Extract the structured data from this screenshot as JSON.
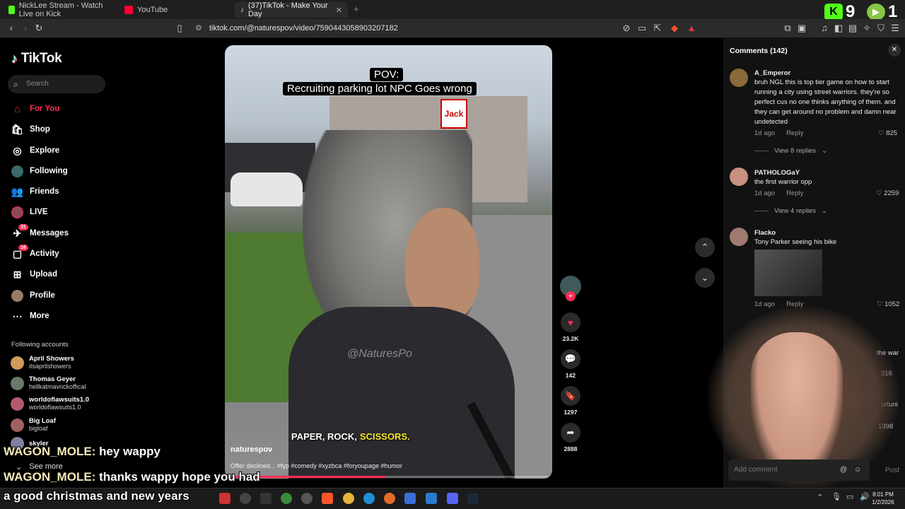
{
  "browser": {
    "tabs": [
      {
        "label": "NickLee Stream - Watch Live on Kick",
        "color": "#53fc18"
      },
      {
        "label": "YouTube",
        "color": "#ff0033"
      },
      {
        "label": "(37)TikTok - Make Your Day",
        "color": "#ffffff"
      }
    ],
    "url": "tiktok.com/@naturespov/video/7590443058903207182"
  },
  "overlay": {
    "kick_count": "9",
    "rumble_count": "1"
  },
  "sidebar": {
    "logo": "TikTok",
    "search_placeholder": "Search",
    "nav": [
      {
        "label": "For You",
        "icon": "home-icon"
      },
      {
        "label": "Shop",
        "icon": "shop-icon"
      },
      {
        "label": "Explore",
        "icon": "compass-icon"
      },
      {
        "label": "Following",
        "icon": "following-icon"
      },
      {
        "label": "Friends",
        "icon": "friends-icon"
      },
      {
        "label": "LIVE",
        "icon": "live-icon"
      },
      {
        "label": "Messages",
        "icon": "messages-icon",
        "badge": "31"
      },
      {
        "label": "Activity",
        "icon": "activity-icon",
        "badge": "16"
      },
      {
        "label": "Upload",
        "icon": "upload-icon"
      },
      {
        "label": "Profile",
        "icon": "profile-icon"
      },
      {
        "label": "More",
        "icon": "more-icon"
      }
    ],
    "following_title": "Following accounts",
    "accounts": [
      {
        "name": "April Showers",
        "handle": "itsaprilshowers"
      },
      {
        "name": "Thomas Geyer",
        "handle": "hellkatmavrickoffical"
      },
      {
        "name": "worldoflawsuits1.0",
        "handle": "worldoflawsuits1.0"
      },
      {
        "name": "Big Loaf",
        "handle": "bigloaf"
      },
      {
        "name": "skyler",
        "handle": ""
      }
    ],
    "see_more": "See more"
  },
  "video": {
    "pov_line1": "POV:",
    "pov_line2": "Recruiting parking lot NPC Goes wrong",
    "caption_part1": "PAPER, ROCK,",
    "caption_part2": "SCISSORS.",
    "author": "naturespov",
    "description": "Offer declined... #fyp #comedy #xyzbca #foryoupage #humor",
    "watermark": "@NaturesPo"
  },
  "actions": {
    "likes": "23.2K",
    "comments": "142",
    "saves": "1297",
    "shares": "2888"
  },
  "comments_panel": {
    "title": "Comments (142)",
    "items": [
      {
        "user": "A_Emperor",
        "text": "bruh NGL this is top tier game on how to start running a city using street warriors. they're so perfect cus no one thinks anything of them. and they can get around no problem and damn near undetected",
        "time": "1d ago",
        "reply": "Reply",
        "likes": "825",
        "view": "View 8 replies"
      },
      {
        "user": "PATHOLOGaY",
        "text": "the first warrior opp",
        "time": "1d ago",
        "reply": "Reply",
        "likes": "2259",
        "view": "View 4 replies"
      },
      {
        "user": "Flacko",
        "text": "Tony Parker seeing his bike",
        "time": "1d ago",
        "reply": "Reply",
        "likes": "1052"
      }
    ],
    "partial_text": "the war",
    "partial_like1": "316",
    "partial_text2": "ortuni",
    "partial_like2": "1398",
    "add_comment": "Add comment",
    "post": "Post"
  },
  "chat": [
    {
      "user": "WAGON_MOLE:",
      "msg": " hey wappy"
    },
    {
      "user": "WAGON_MOLE:",
      "msg": " thanks wappy hope you had"
    },
    {
      "user": "",
      "msg": "a good christmas and new years"
    }
  ],
  "taskbar": {
    "time": "8:01 PM",
    "date": "1/2/2026"
  }
}
